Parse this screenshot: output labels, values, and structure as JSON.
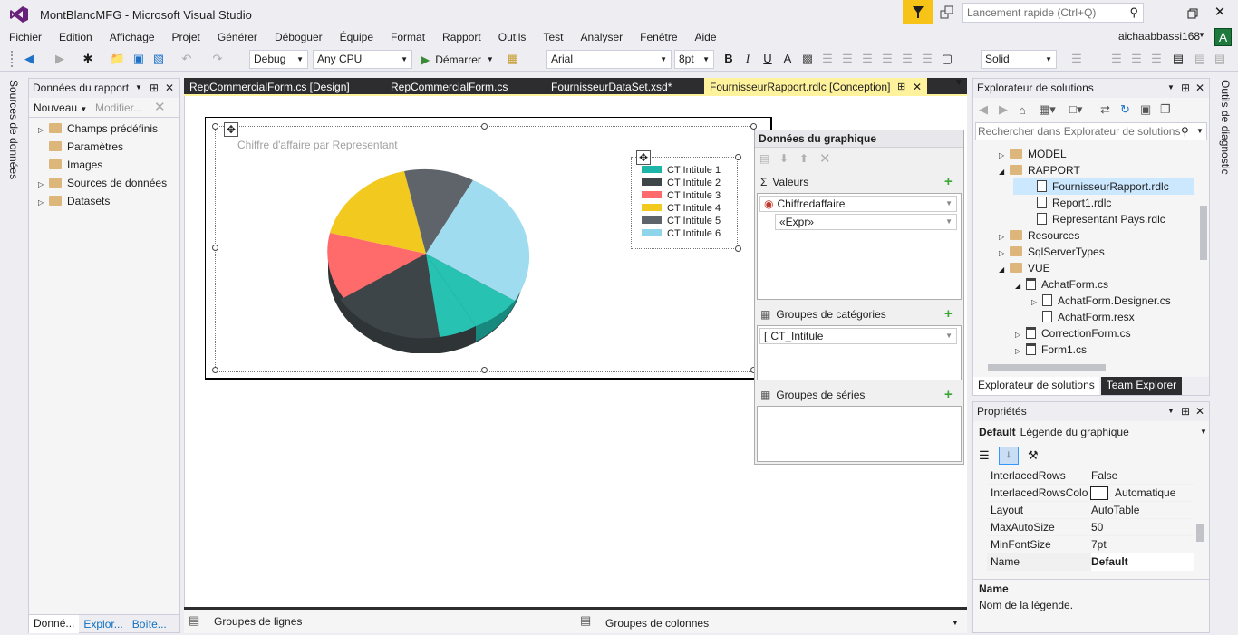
{
  "titlebar": {
    "title": "MontBlancMFG - Microsoft Visual Studio",
    "quick_launch_placeholder": "Lancement rapide (Ctrl+Q)",
    "user": "aichaabbassi168",
    "avatar_letter": "A"
  },
  "menu": [
    "Fichier",
    "Edition",
    "Affichage",
    "Projet",
    "Générer",
    "Déboguer",
    "Équipe",
    "Format",
    "Rapport",
    "Outils",
    "Test",
    "Analyser",
    "Fenêtre",
    "Aide"
  ],
  "toolbar": {
    "config": "Debug",
    "platform": "Any CPU",
    "start_label": "Démarrer",
    "font": "Arial",
    "font_size": "8pt",
    "bold": "B",
    "italic": "I",
    "underline": "U",
    "border_style": "Solid"
  },
  "left_panel": {
    "title": "Données du rapport",
    "new_label": "Nouveau",
    "edit_label": "Modifier...",
    "items": [
      "Champs prédéfinis",
      "Paramètres",
      "Images",
      "Sources de données",
      "Datasets"
    ],
    "bottom_tabs": [
      "Donné...",
      "Explor...",
      "Boîte..."
    ],
    "side_tab": "Sources de données"
  },
  "doc_tabs": [
    "RepCommercialForm.cs [Design]",
    "RepCommercialForm.cs",
    "FournisseurDataSet.xsd*",
    "FournisseurRapport.rdlc [Conception]"
  ],
  "chart": {
    "title": "Chiffre d'affaire par Representant",
    "legend": [
      {
        "label": "CT Intitule 1",
        "color": "#1cb5a7"
      },
      {
        "label": "CT Intitule 2",
        "color": "#3d4549"
      },
      {
        "label": "CT Intitule 3",
        "color": "#ff6b6b"
      },
      {
        "label": "CT Intitule 4",
        "color": "#f2c91f"
      },
      {
        "label": "CT Intitule 5",
        "color": "#5e6469"
      },
      {
        "label": "CT Intitule 6",
        "color": "#8fd5ea"
      }
    ]
  },
  "chart_panel": {
    "title": "Données du graphique",
    "values_label": "Valeurs",
    "value_field": "Chiffredaffaire",
    "expr_field": "«Expr»",
    "categories_label": "Groupes de catégories",
    "category_field": "CT_Intitule",
    "series_label": "Groupes de séries"
  },
  "bottom_groups": {
    "rows": "Groupes de lignes",
    "cols": "Groupes de colonnes"
  },
  "solution_explorer": {
    "title": "Explorateur de solutions",
    "search_placeholder": "Rechercher dans Explorateur de solutions",
    "items": [
      {
        "label": "MODEL",
        "type": "folder"
      },
      {
        "label": "RAPPORT",
        "type": "folder"
      },
      {
        "label": "FournisseurRapport.rdlc",
        "type": "file"
      },
      {
        "label": "Report1.rdlc",
        "type": "file"
      },
      {
        "label": "Representant Pays.rdlc",
        "type": "file"
      },
      {
        "label": "Resources",
        "type": "folder"
      },
      {
        "label": "SqlServerTypes",
        "type": "folder"
      },
      {
        "label": "VUE",
        "type": "folder"
      },
      {
        "label": "AchatForm.cs",
        "type": "form"
      },
      {
        "label": "AchatForm.Designer.cs",
        "type": "code"
      },
      {
        "label": "AchatForm.resx",
        "type": "code"
      },
      {
        "label": "CorrectionForm.cs",
        "type": "form"
      },
      {
        "label": "Form1.cs",
        "type": "form"
      }
    ],
    "tabs": [
      "Explorateur de solutions",
      "Team Explorer"
    ],
    "side_tab": "Outils de diagnostic"
  },
  "properties": {
    "title": "Propriétés",
    "object_bold": "Default",
    "object_name": "Légende du graphique",
    "rows": [
      {
        "name": "InterlacedRows",
        "value": "False"
      },
      {
        "name": "InterlacedRowsColo",
        "value": "Automatique"
      },
      {
        "name": "Layout",
        "value": "AutoTable"
      },
      {
        "name": "MaxAutoSize",
        "value": "50"
      },
      {
        "name": "MinFontSize",
        "value": "7pt"
      },
      {
        "name": "Name",
        "value": "Default"
      }
    ],
    "desc_title": "Name",
    "desc_text": "Nom de la légende."
  },
  "colors": {
    "accent": "#007acc",
    "tab_active": "#fff29d",
    "vs_purple": "#68217a",
    "filter": "#f7c316",
    "doc_tab_bg": "#2d2d30"
  }
}
